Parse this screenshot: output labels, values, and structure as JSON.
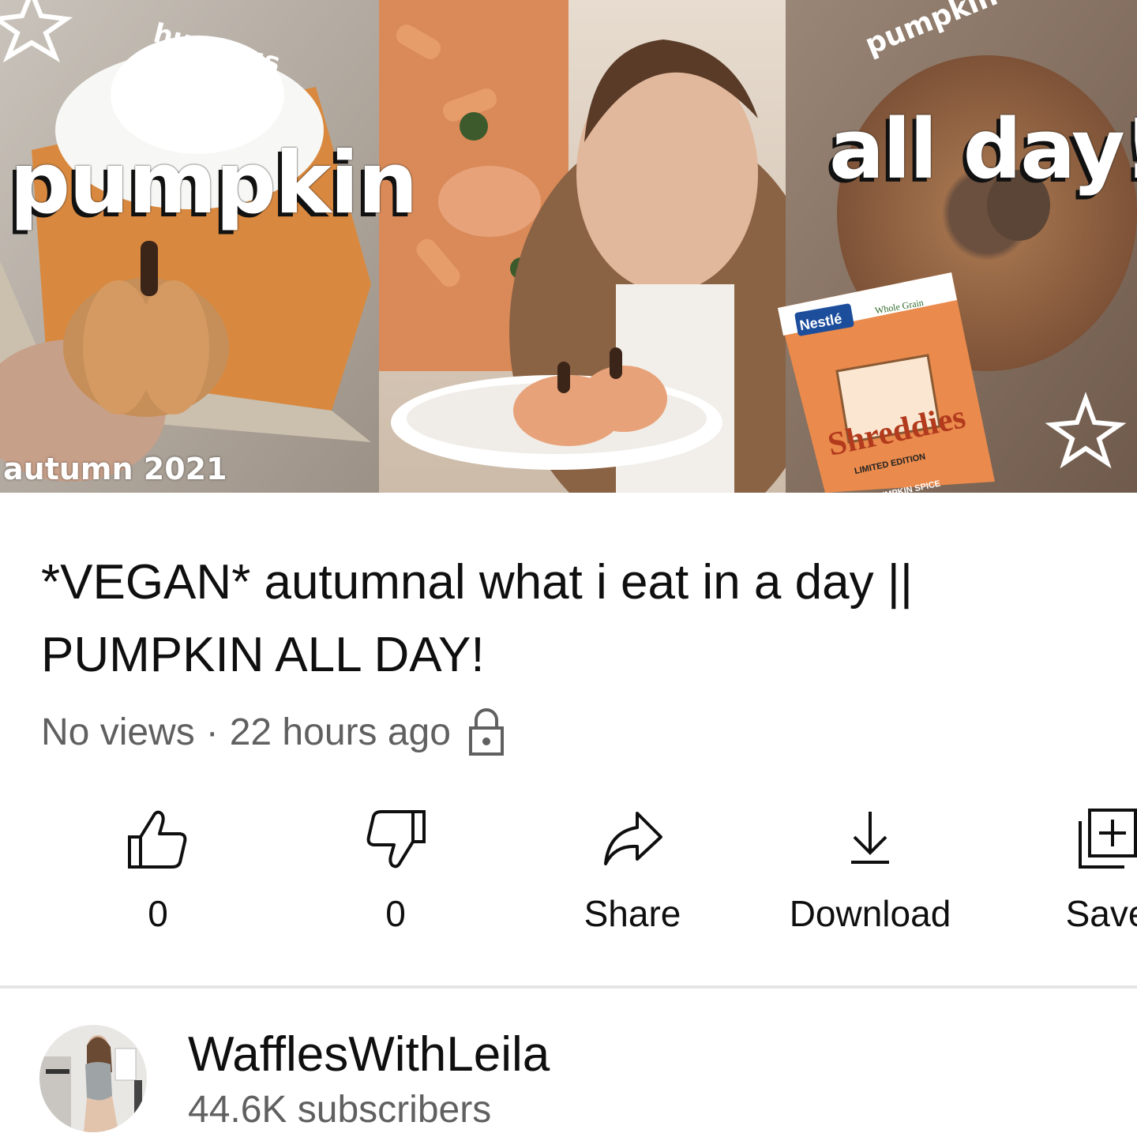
{
  "thumbnail": {
    "overlay_text": {
      "top_left_curved": "hummus",
      "left_big": "pumpkin",
      "bottom_left": "autumn 2021",
      "top_right_curved": "pumpkin spice",
      "right_big": "all day!"
    },
    "product_box": {
      "brand": "Nestlé",
      "badge": "Whole Grain",
      "name": "Shreddies",
      "edition": "LIMITED EDITION",
      "flavor": "PUMPKIN SPICE"
    }
  },
  "video": {
    "title": "*VEGAN* autumnal what i eat in a day || PUMPKIN ALL DAY!",
    "views": "No views",
    "separator": "·",
    "age": "22 hours ago",
    "visibility_icon": "lock-icon"
  },
  "actions": {
    "like_count": "0",
    "dislike_count": "0",
    "share_label": "Share",
    "download_label": "Download",
    "save_label": "Save"
  },
  "channel": {
    "name": "WafflesWithLeila",
    "subscribers": "44.6K subscribers"
  },
  "colors": {
    "text_primary": "#0f0f0f",
    "text_secondary": "#606060",
    "divider": "#e5e5e5",
    "pumpkin_orange": "#d9783a"
  }
}
